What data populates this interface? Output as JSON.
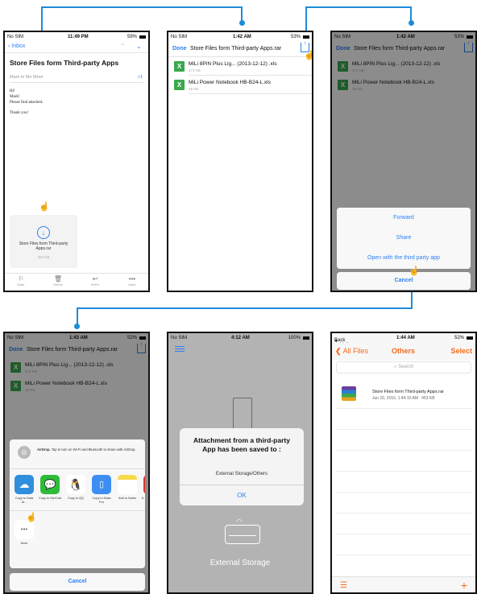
{
  "colors": {
    "ios_blue": "#2f7ff0",
    "connector": "#1e8bd8",
    "orange": "#f26b1d",
    "xls_green": "#3aa84b"
  },
  "s1": {
    "status": {
      "left": "No SIM",
      "time": "11:49 PM",
      "battery": "59%"
    },
    "nav_back": "Inbox",
    "subject": "Store Files form Third-party Apps",
    "meta_from": "Mark to Me More",
    "meta_count": "1",
    "body": [
      "Hi!",
      "Mark!",
      "Please find attached..",
      "Thank you!"
    ],
    "attachment": {
      "name": "Store Files form Third-party Apps.rar",
      "size": "453 KB"
    },
    "toolbar": [
      "Mark",
      "Delete",
      "ReFix",
      "More"
    ]
  },
  "s2": {
    "status": {
      "left": "No SIM",
      "time": "1:42 AM",
      "battery": "53%"
    },
    "done": "Done",
    "title": "Store Files form Third-party Apps.rar",
    "files": [
      {
        "name": "MiLi 8PIN Plus Lig... (2013-12-12) .xls",
        "size": "473 KB"
      },
      {
        "name": "MiLi Power Notebook HB-B24-L.xls",
        "size": "15 KB"
      }
    ]
  },
  "s3": {
    "status": {
      "left": "No SIM",
      "time": "1:42 AM",
      "battery": "53%"
    },
    "done": "Done",
    "title": "Store Files form Third-party Apps.rar",
    "files": [
      {
        "name": "MiLi 8PIN Plus Lig... (2013-12-12) .xls",
        "size": "473 KB"
      },
      {
        "name": "MiLi Power Notebook HB-B24-L.xls",
        "size": "15 KB"
      }
    ],
    "actions": [
      "Forward",
      "Share",
      "Open with the third party app"
    ],
    "cancel": "Cancel"
  },
  "s4": {
    "status": {
      "left": "No SIM",
      "time": "1:43 AM",
      "battery": "52%"
    },
    "done": "Done",
    "title": "Store Files form Third-party Apps.rar",
    "files": [
      {
        "name": "MiLi 8PIN Plus Lig... (2013-12-12) .xls",
        "size": "473 KB"
      },
      {
        "name": "MiLi Power Notebook HB-B24-L.xls",
        "size": "15 KB"
      }
    ],
    "airdrop_bold": "AirDrop.",
    "airdrop_text": "Tap to turn on Wi-Fi and Bluetooth to share with AirDrop.",
    "apps": [
      "Copy to Data Al...",
      "Copy to WeChat",
      "Copy to QQ",
      "Copy to iData Pro",
      "Add to Notes",
      "A"
    ],
    "more": "More",
    "cancel": "Cancel"
  },
  "s5": {
    "status": {
      "left": "No SIM",
      "time": "4:12 AM",
      "battery": "100%"
    },
    "alert_title": "Attachment from a third-party App has been saved to :",
    "alert_msg": "External Storage/Others",
    "ok": "OK",
    "storage_label": "External Storage"
  },
  "s6": {
    "status": {
      "left": "Back to Mail Master",
      "time": "1:44 AM",
      "battery": "52%"
    },
    "back": "All Files",
    "title": "Others",
    "select": "Select",
    "search": "Search",
    "file": {
      "name": "Store Files form Third-party Apps.rar",
      "meta": "Jun 15, 2016, 1:44:10 AM   453 KB"
    },
    "add": "+"
  }
}
